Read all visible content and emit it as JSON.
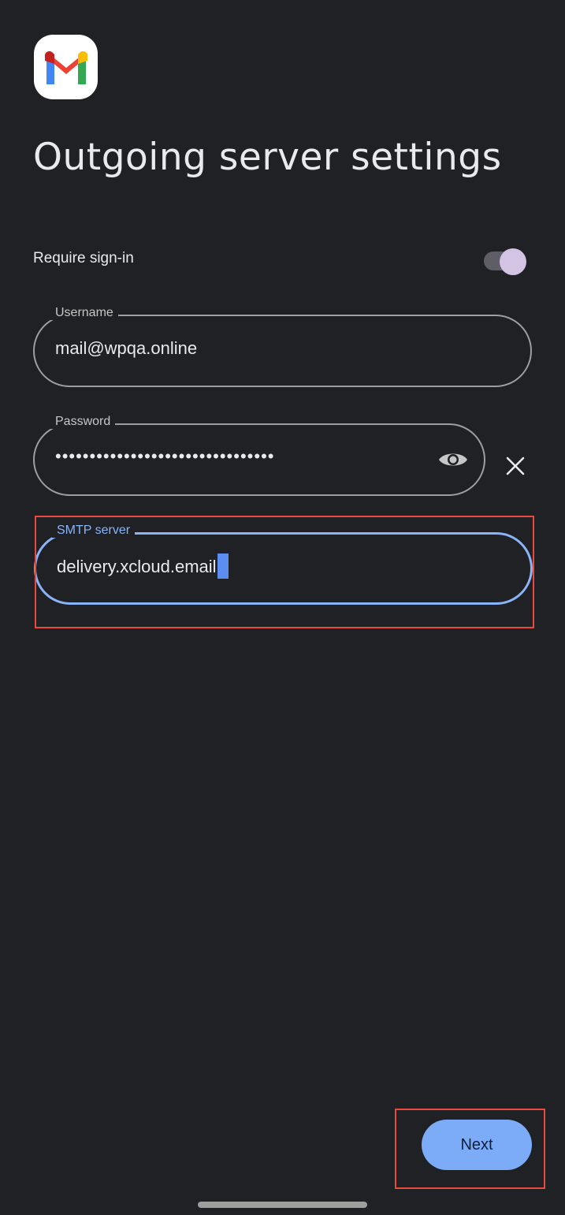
{
  "screen": {
    "title": "Outgoing server settings"
  },
  "require_signin": {
    "label": "Require sign-in",
    "enabled": true
  },
  "fields": {
    "username": {
      "label": "Username",
      "value": "mail@wpqa.online"
    },
    "password": {
      "label": "Password",
      "value": "••••••••••••••••••••••••••••••••"
    },
    "smtp_server": {
      "label": "SMTP server",
      "value": "delivery.xcloud.email"
    }
  },
  "actions": {
    "next_label": "Next"
  },
  "icons": {
    "logo": "gmail-logo-icon",
    "show_password": "eye-icon",
    "clear": "close-icon"
  },
  "colors": {
    "background": "#202124",
    "accent": "#8ab4f8",
    "button": "#7cacf8",
    "toggle_thumb": "#d4c4e4",
    "highlight": "#e94a3c"
  }
}
